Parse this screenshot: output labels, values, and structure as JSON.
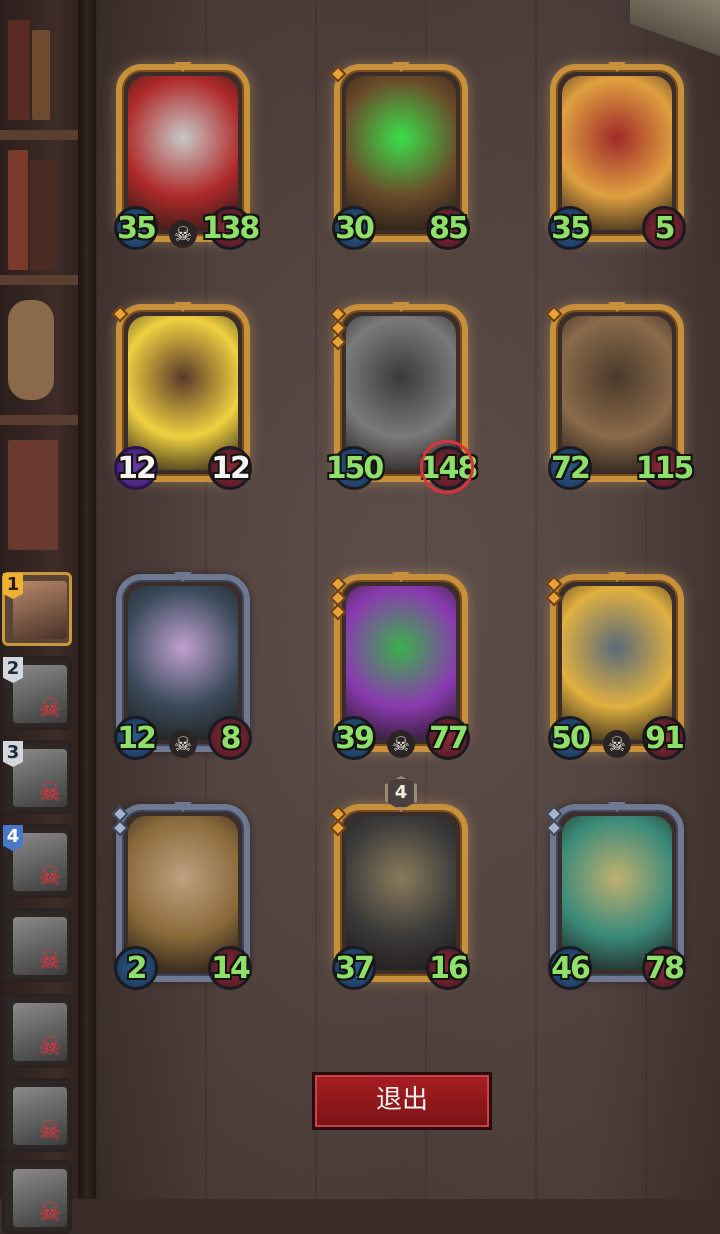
{
  "turn_order": [
    {
      "order": "1",
      "state": "active",
      "dead": false
    },
    {
      "order": "2",
      "state": "dead",
      "dead": true
    },
    {
      "order": "3",
      "state": "dead",
      "dead": true
    },
    {
      "order": "4",
      "state": "dead",
      "dead": true,
      "order_style": "blue"
    },
    {
      "order": "",
      "state": "dead",
      "dead": true
    },
    {
      "order": "",
      "state": "dead",
      "dead": true
    },
    {
      "order": "",
      "state": "dead",
      "dead": true
    },
    {
      "order": "",
      "state": "dead",
      "dead": true
    }
  ],
  "dead_icon": "crossed-skull-icon",
  "cards": [
    {
      "name": "armored-helmet-warrior",
      "attack": "35",
      "health": "138",
      "frame": "gold",
      "pips": 0,
      "skull": true,
      "art_colors": [
        "#b02a2a",
        "#c8c8c8"
      ]
    },
    {
      "name": "treant",
      "attack": "30",
      "health": "85",
      "frame": "gold",
      "pips": 1,
      "skull": false,
      "art_colors": [
        "#6a4a2a",
        "#3ae04a"
      ]
    },
    {
      "name": "bearded-dwarf",
      "attack": "35",
      "health": "5",
      "frame": "gold",
      "pips": 0,
      "skull": false,
      "art_colors": [
        "#e0a040",
        "#a02a2a"
      ]
    },
    {
      "name": "flame-brute",
      "attack": "12",
      "health": "12",
      "frame": "gold",
      "pips": 1,
      "skull": false,
      "attack_style": "purple",
      "art_colors": [
        "#f0d040",
        "#5a3a2a"
      ],
      "stat_text_white": true
    },
    {
      "name": "iron-knight",
      "attack": "150",
      "health": "148",
      "frame": "gold",
      "pips": 3,
      "skull": false,
      "targeted": true,
      "art_colors": [
        "#7a7a7a",
        "#3a3a3a"
      ]
    },
    {
      "name": "stitched-ogre",
      "attack": "72",
      "health": "115",
      "frame": "gold",
      "pips": 1,
      "skull": false,
      "art_colors": [
        "#8a6a4a",
        "#4a3a2a"
      ]
    },
    {
      "name": "horned-demoness",
      "attack": "12",
      "health": "8",
      "frame": "silver",
      "pips": 0,
      "skull": true,
      "art_colors": [
        "#3a4a5a",
        "#c0a0d0"
      ]
    },
    {
      "name": "green-dragon-hatchling",
      "attack": "39",
      "health": "77",
      "frame": "gold",
      "pips": 3,
      "skull": true,
      "art_colors": [
        "#8a3ab0",
        "#3ab04a"
      ]
    },
    {
      "name": "golden-maned-dragon",
      "attack": "50",
      "health": "91",
      "frame": "gold",
      "pips": 2,
      "skull": true,
      "art_colors": [
        "#e0b040",
        "#5a6a7a"
      ]
    },
    {
      "name": "adventurer-gunslinger",
      "attack": "2",
      "health": "14",
      "frame": "silver",
      "pips": 2,
      "skull": false,
      "art_colors": [
        "#8a6a3a",
        "#c0a080"
      ]
    },
    {
      "name": "dark-spiked-warrior",
      "attack": "37",
      "health": "16",
      "frame": "gold",
      "pips": 2,
      "skull": false,
      "badge": "4",
      "art_colors": [
        "#3a3a3a",
        "#8a7a5a"
      ]
    },
    {
      "name": "sea-serpent",
      "attack": "46",
      "health": "78",
      "frame": "silver",
      "pips": 2,
      "skull": false,
      "art_colors": [
        "#3a8a7a",
        "#c0b070"
      ]
    }
  ],
  "exit_button": {
    "label": "退出"
  },
  "colors": {
    "stat_text": "#8ee06a",
    "gold_frame": "#c8903a",
    "silver_frame": "#6e7890",
    "exit_button": "#a81e22",
    "dead_mark": "#e8323c"
  }
}
